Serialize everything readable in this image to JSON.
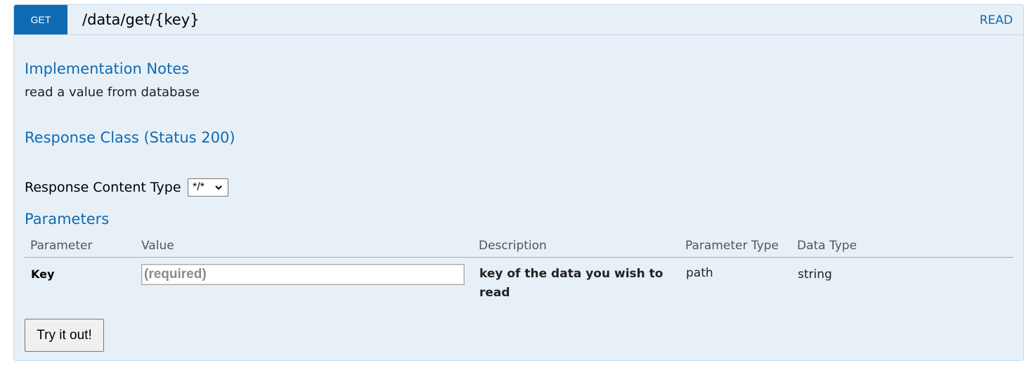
{
  "operation": {
    "method": "GET",
    "path": "/data/get/{key}",
    "summary": "READ"
  },
  "implementation_notes": {
    "heading": "Implementation Notes",
    "text": "read a value from database"
  },
  "response_class": {
    "heading": "Response Class (Status 200)"
  },
  "response_content_type": {
    "label": "Response Content Type",
    "selected": "*/*"
  },
  "parameters": {
    "heading": "Parameters",
    "columns": [
      "Parameter",
      "Value",
      "Description",
      "Parameter Type",
      "Data Type"
    ],
    "rows": [
      {
        "name": "Key",
        "value": "",
        "placeholder": "(required)",
        "description": "key of the data you wish to read",
        "param_type": "path",
        "data_type": "string"
      }
    ]
  },
  "actions": {
    "try_label": "Try it out!"
  },
  "colors": {
    "method_bg": "#0f6ab4",
    "panel_bg": "#e8f0f7",
    "panel_border": "#c3d9ec",
    "heading_text": "#0f6ab4"
  },
  "icons": {
    "select_arrow": "chevron-down-icon"
  }
}
